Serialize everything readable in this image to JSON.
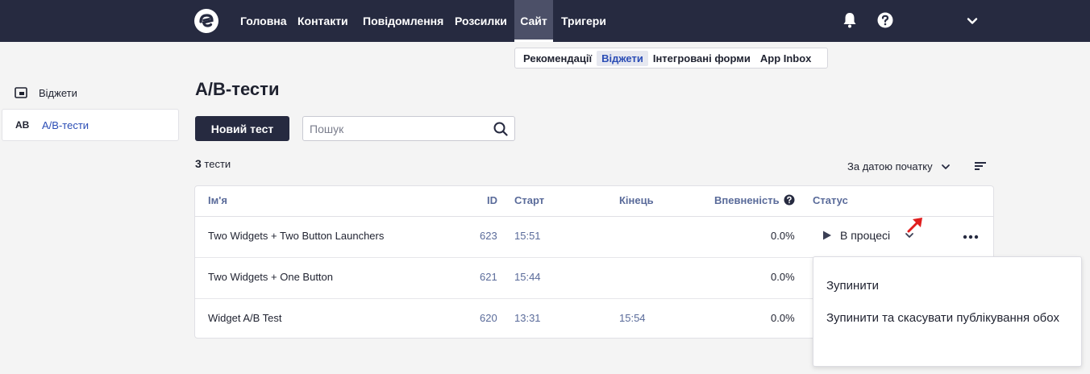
{
  "nav": {
    "items": [
      {
        "label": "Головна"
      },
      {
        "label": "Контакти"
      },
      {
        "label": "Повідомлення"
      },
      {
        "label": "Розсилки"
      },
      {
        "label": "Сайт",
        "active": true
      },
      {
        "label": "Тригери"
      }
    ],
    "icons": [
      "bell-icon",
      "help-icon",
      "chevron-down-icon"
    ]
  },
  "subnav": {
    "items": [
      {
        "label": "Рекомендації"
      },
      {
        "label": "Віджети",
        "active": true
      },
      {
        "label": "Інтегровані форми"
      },
      {
        "label": "App Inbox"
      }
    ]
  },
  "sidebar": {
    "items": [
      {
        "label": "Віджети",
        "icon": "widget-icon"
      },
      {
        "label": "A/B-тести",
        "badge": "AB",
        "active": true
      }
    ]
  },
  "page": {
    "title": "A/B-тести",
    "new_button": "Новий тест",
    "search_placeholder": "Пошук",
    "count": "3",
    "count_label": "тести",
    "sort_label": "За датою початку"
  },
  "table": {
    "columns": [
      "Ім'я",
      "ID",
      "Старт",
      "Кінець",
      "Впевненість",
      "Статус"
    ],
    "rows": [
      {
        "name": "Two Widgets + Two Button Launchers",
        "id": "623",
        "start": "15:51",
        "end": "",
        "confidence": "0.0%",
        "status": "В процесі"
      },
      {
        "name": "Two Widgets + One Button",
        "id": "621",
        "start": "15:44",
        "end": "",
        "confidence": "0.0%",
        "status": ""
      },
      {
        "name": "Widget A/B Test",
        "id": "620",
        "start": "13:31",
        "end": "15:54",
        "confidence": "0.0%",
        "status": ""
      }
    ]
  },
  "dropdown": {
    "items": [
      "Зупинити",
      "Зупинити та скасувати публікування обох"
    ]
  },
  "colors": {
    "nav_bg": "#262a40",
    "accent_blue": "#2b4db5",
    "annotation_red": "#e01e1e"
  }
}
